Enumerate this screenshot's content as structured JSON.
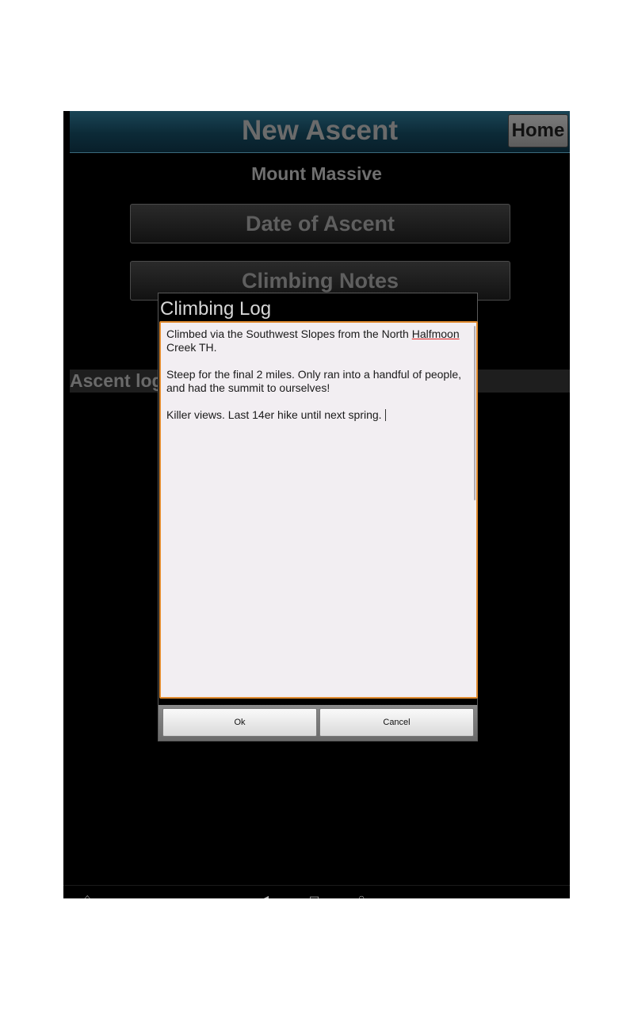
{
  "header": {
    "title": "New Ascent",
    "home_label": "Home"
  },
  "peak": {
    "name": "Mount Massive"
  },
  "buttons": {
    "date_label": "Date of Ascent",
    "notes_label": "Climbing Notes"
  },
  "section": {
    "label": "Ascent log"
  },
  "dialog": {
    "title": "Climbing Log",
    "notes": {
      "line1_before": "Climbed via the Southwest Slopes from the North ",
      "line1_word": "Halfmoon",
      "line1_after": " Creek TH.",
      "para2": "Steep for the final 2 miles.  Only ran into a handful of people, and had the summit to ourselves!",
      "para3": "Killer views.  Last 14er hike until next spring."
    },
    "ok_label": "Ok",
    "cancel_label": "Cancel"
  },
  "nav_icons": [
    "home-icon",
    "back-icon",
    "recent-apps-icon",
    "search-icon"
  ],
  "colors": {
    "header_bg": "#0c2a37",
    "notes_border": "#e08a2e",
    "notes_bg": "#f2eef2"
  }
}
